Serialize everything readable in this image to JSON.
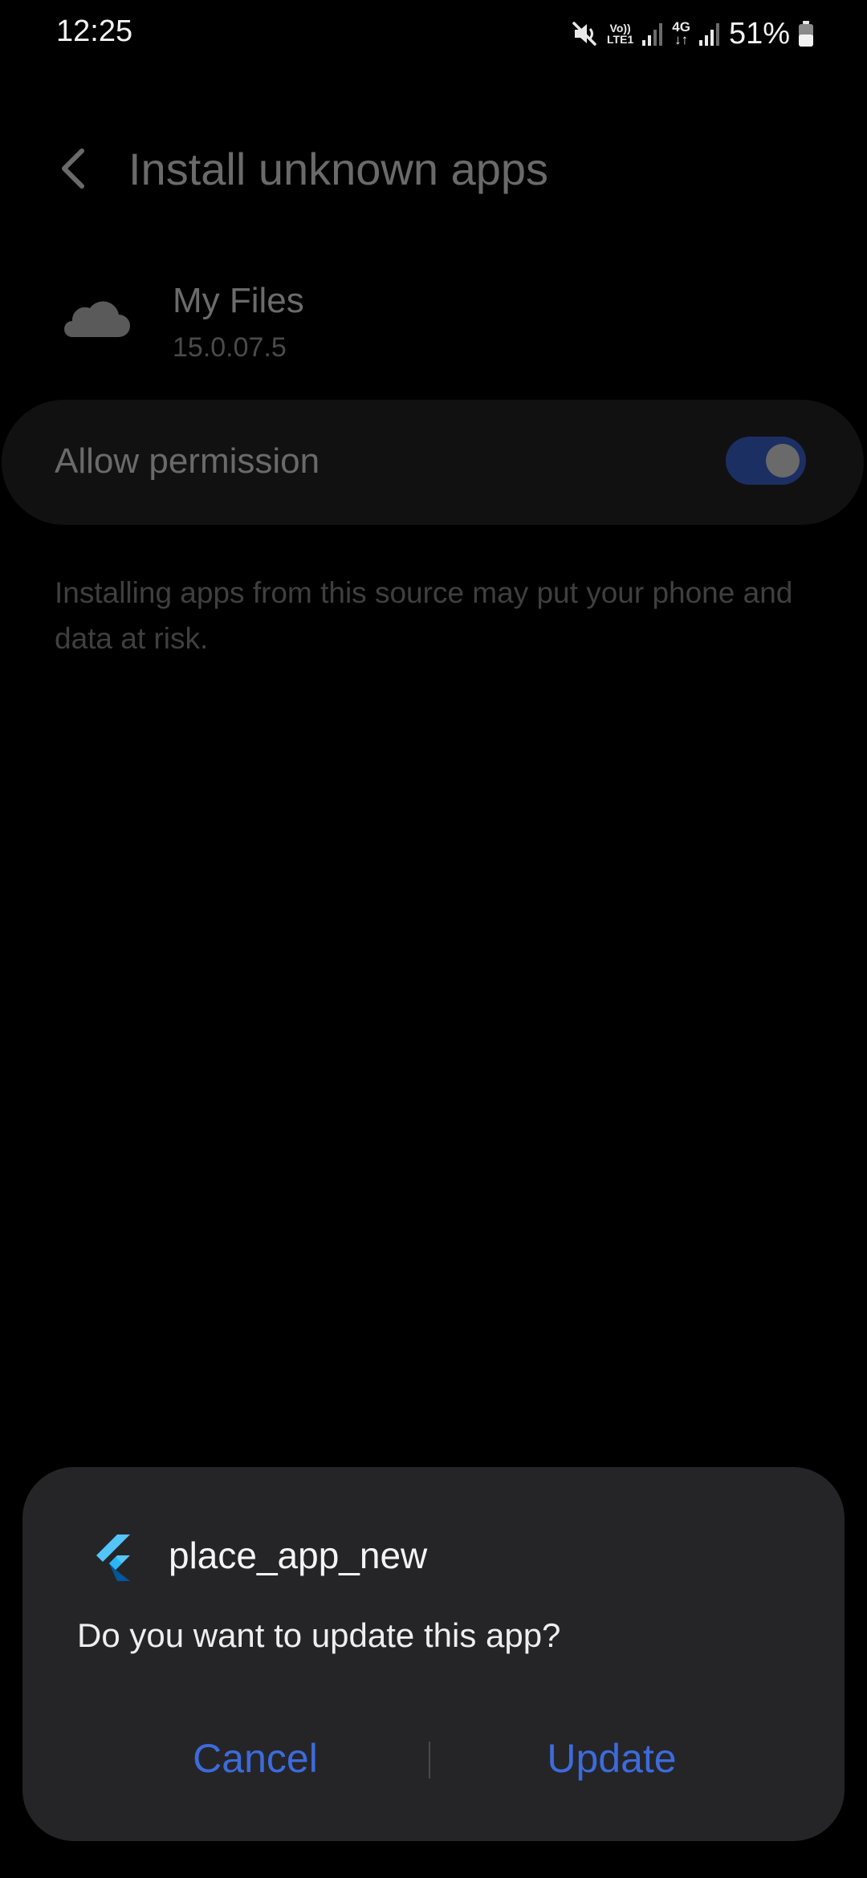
{
  "status_bar": {
    "time": "12:25",
    "volte_top": "Vo))",
    "volte_bottom": "LTE1",
    "network_top": "4G",
    "network_bottom": "↓↑",
    "battery": "51%",
    "icons": [
      "mute-icon",
      "signal-icon",
      "signal-icon",
      "battery-icon"
    ]
  },
  "header": {
    "title": "Install unknown apps",
    "back_icon": "chevron-left-icon"
  },
  "app": {
    "name": "My Files",
    "version": "15.0.07.5",
    "icon": "cloud-icon"
  },
  "permission": {
    "label": "Allow permission",
    "enabled": true
  },
  "warning": {
    "text": "Installing apps from this source may put your phone and data at risk."
  },
  "dialog": {
    "app_name": "place_app_new",
    "app_icon": "flutter-icon",
    "message": "Do you want to update this app?",
    "cancel_label": "Cancel",
    "update_label": "Update"
  },
  "colors": {
    "background": "#000000",
    "dialog": "#252528",
    "accent": "#3d6bdc",
    "toggle_track": "#1c2f63"
  }
}
